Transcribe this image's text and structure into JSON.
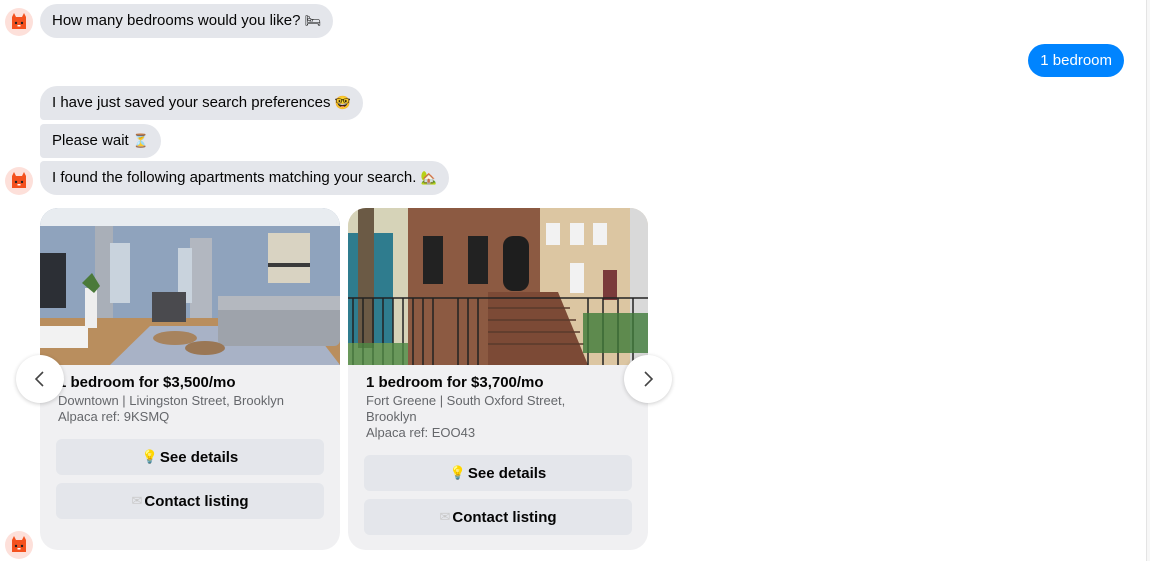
{
  "messages": [
    {
      "id": "m1",
      "sender": "bot",
      "text": "How many bedrooms would you like? ",
      "emoji": "🛏"
    },
    {
      "id": "m2",
      "sender": "user",
      "text": "1 bedroom"
    },
    {
      "id": "m3",
      "sender": "bot",
      "text": "I have just saved your search preferences ",
      "emoji": "🤓"
    },
    {
      "id": "m4",
      "sender": "bot",
      "text": "Please wait ",
      "emoji": "⏳"
    },
    {
      "id": "m5",
      "sender": "bot",
      "text": "I found the following apartments matching your search. ",
      "emoji": "🏡"
    }
  ],
  "listings": [
    {
      "title": "1 bedroom for $3,500/mo",
      "location": "Downtown | Livingston Street, Brooklyn",
      "ref": "Alpaca ref: 9KSMQ",
      "image": "living-room-photo",
      "buttons": [
        {
          "emoji": "💡",
          "label": "See details"
        },
        {
          "emoji": "✉",
          "label": "Contact listing"
        }
      ]
    },
    {
      "title": "1 bedroom for $3,700/mo",
      "location_line1": "Fort Greene | South Oxford Street,",
      "location_line2": "Brooklyn",
      "ref": "Alpaca ref: EOO43",
      "image": "brownstone-photo",
      "buttons": [
        {
          "emoji": "💡",
          "label": "See details"
        },
        {
          "emoji": "✉",
          "label": "Contact listing"
        }
      ]
    }
  ],
  "carousel": {
    "prev_icon": "chevron-left-icon",
    "next_icon": "chevron-right-icon"
  },
  "colors": {
    "user_bubble": "#0084ff",
    "bot_bubble": "#e4e6eb",
    "card_bg": "#f0f0f2",
    "avatar_bg": "#fde0da",
    "avatar_fg": "#f4511e"
  }
}
